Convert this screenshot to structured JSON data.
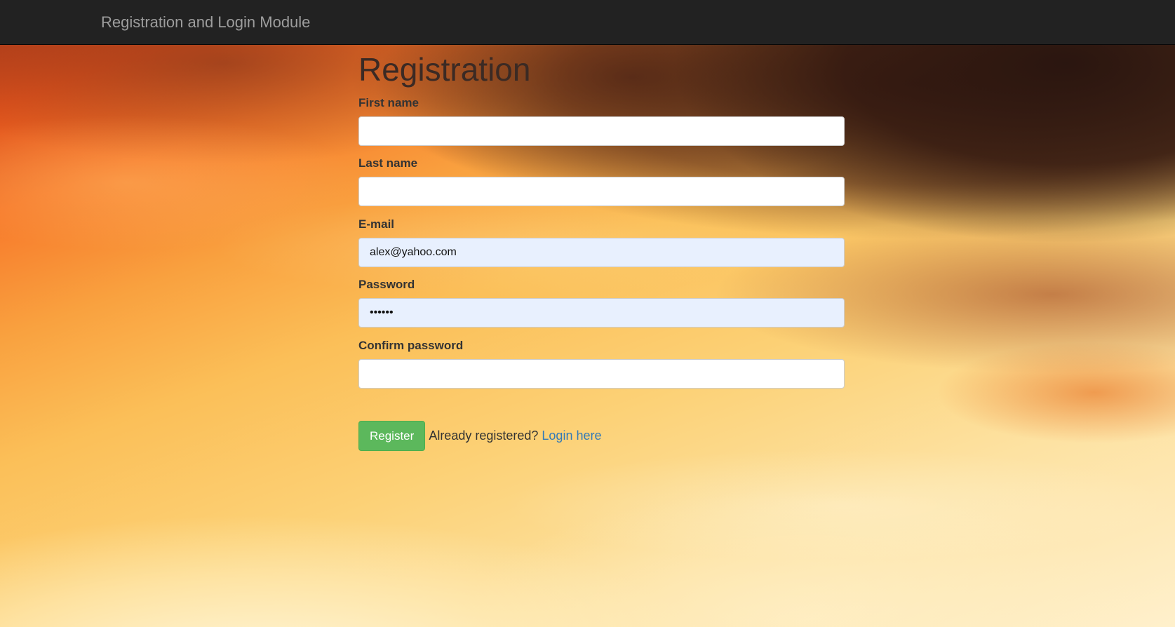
{
  "navbar": {
    "brand": "Registration and Login Module"
  },
  "form": {
    "title": "Registration",
    "fields": [
      {
        "label": "First name",
        "value": "",
        "type": "text",
        "autofilled": false
      },
      {
        "label": "Last name",
        "value": "",
        "type": "text",
        "autofilled": false
      },
      {
        "label": "E-mail",
        "value": "alex@yahoo.com",
        "type": "email",
        "autofilled": true
      },
      {
        "label": "Password",
        "value": "••••••",
        "type": "password",
        "autofilled": true
      },
      {
        "label": "Confirm password",
        "value": "",
        "type": "password",
        "autofilled": false
      }
    ],
    "register_label": "Register",
    "already_text": "Already registered?",
    "login_link_text": "Login here"
  },
  "colors": {
    "navbar_bg": "#222222",
    "brand_text": "#9d9d9d",
    "register_button": "#5cb85c",
    "link": "#337ab7",
    "autofill_bg": "#e8f0fe"
  }
}
